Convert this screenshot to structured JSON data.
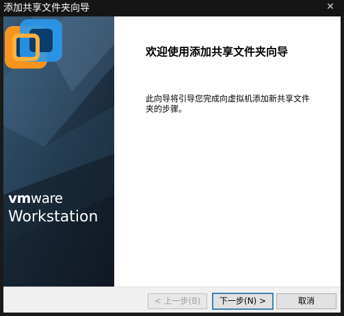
{
  "window": {
    "title": "添加共享文件夹向导",
    "close_glyph": "✕"
  },
  "banner": {
    "brand_vm": "vm",
    "brand_ware": "ware",
    "product": "Workstation",
    "logo_colors": {
      "outer": "#f7941d",
      "inner": "#1e90ff"
    }
  },
  "content": {
    "heading": "欢迎使用添加共享文件夹向导",
    "description": "此向导将引导您完成向虚拟机添加新共享文件夹的步骤。"
  },
  "buttons": {
    "back": "< 上一步(B)",
    "next": "下一步(N) >",
    "cancel": "取消"
  }
}
